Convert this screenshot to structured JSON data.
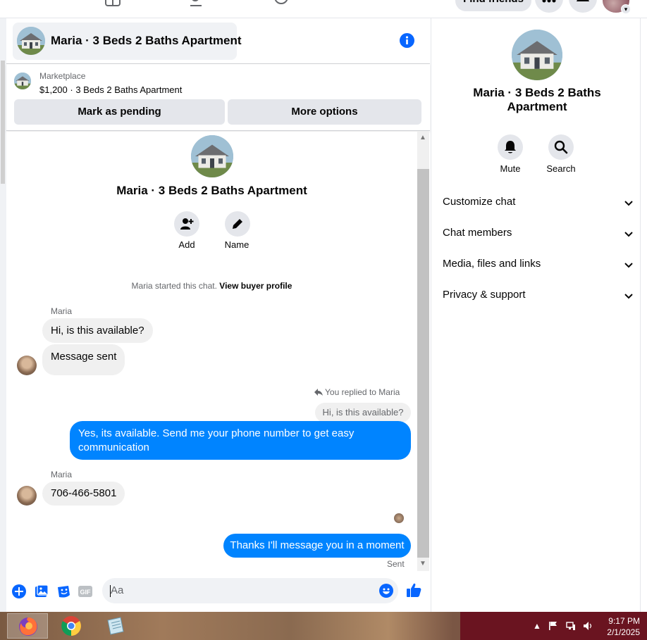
{
  "topnav": {
    "find_friends_label": "Find friends"
  },
  "chat_header": {
    "title": "Maria · 3 Beds 2 Baths Apartment"
  },
  "marketplace": {
    "label": "Marketplace",
    "listing": "$1,200 · 3 Beds 2 Baths Apartment",
    "mark_pending_label": "Mark as pending",
    "more_options_label": "More options"
  },
  "conversation": {
    "title": "Maria · 3 Beds 2 Baths Apartment",
    "add_label": "Add",
    "name_label": "Name",
    "started_text": "Maria started this chat.",
    "view_profile_link": "View buyer profile",
    "messages": [
      {
        "sender": "Maria",
        "text": "Hi, is this available?"
      },
      {
        "sender": "Maria",
        "text": "Message sent"
      },
      {
        "sender": "You",
        "replied_label": "You replied to Maria",
        "quoted": "Hi, is this available?",
        "text": "Yes, its available. Send me your phone number to get easy communication"
      },
      {
        "sender": "Maria",
        "text": "706-466-5801"
      },
      {
        "sender": "You",
        "text": "Thanks I'll message you in a moment",
        "status": "Sent"
      }
    ]
  },
  "composer": {
    "placeholder": "Aa"
  },
  "right_panel": {
    "title": "Maria · 3 Beds 2 Baths Apartment",
    "mute_label": "Mute",
    "search_label": "Search",
    "sections": [
      "Customize chat",
      "Chat members",
      "Media, files and links",
      "Privacy & support"
    ]
  },
  "taskbar": {
    "time": "9:17 PM",
    "date": "2/1/2025"
  },
  "colors": {
    "messenger_blue": "#0084ff",
    "bubble_gray": "#f0f0f0",
    "button_gray": "#e4e6eb"
  }
}
